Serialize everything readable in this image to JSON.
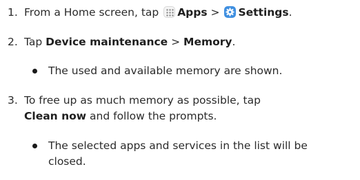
{
  "steps": [
    {
      "number": "1.",
      "prefix": "From a Home screen, tap ",
      "apps": "Apps",
      "sep": " > ",
      "settings": "Settings",
      "suffix": "."
    },
    {
      "number": "2.",
      "prefix": "Tap ",
      "b1": "Device maintenance",
      "sep": " > ",
      "b2": "Memory",
      "suffix": "."
    },
    {
      "bullet": "The used and available memory are shown."
    },
    {
      "number": "3.",
      "line1": "To free up as much memory as possible, tap",
      "b1": "Clean now",
      "line2_suffix": " and follow the prompts."
    },
    {
      "bullet_line1": "The selected apps and services in the list will be",
      "bullet_line2": "closed."
    }
  ],
  "icons": {
    "apps": "apps-grid-icon",
    "settings": "settings-gear-icon"
  },
  "colors": {
    "settings_icon_bg": "#3f8fe0",
    "text": "#2b2b2b"
  }
}
